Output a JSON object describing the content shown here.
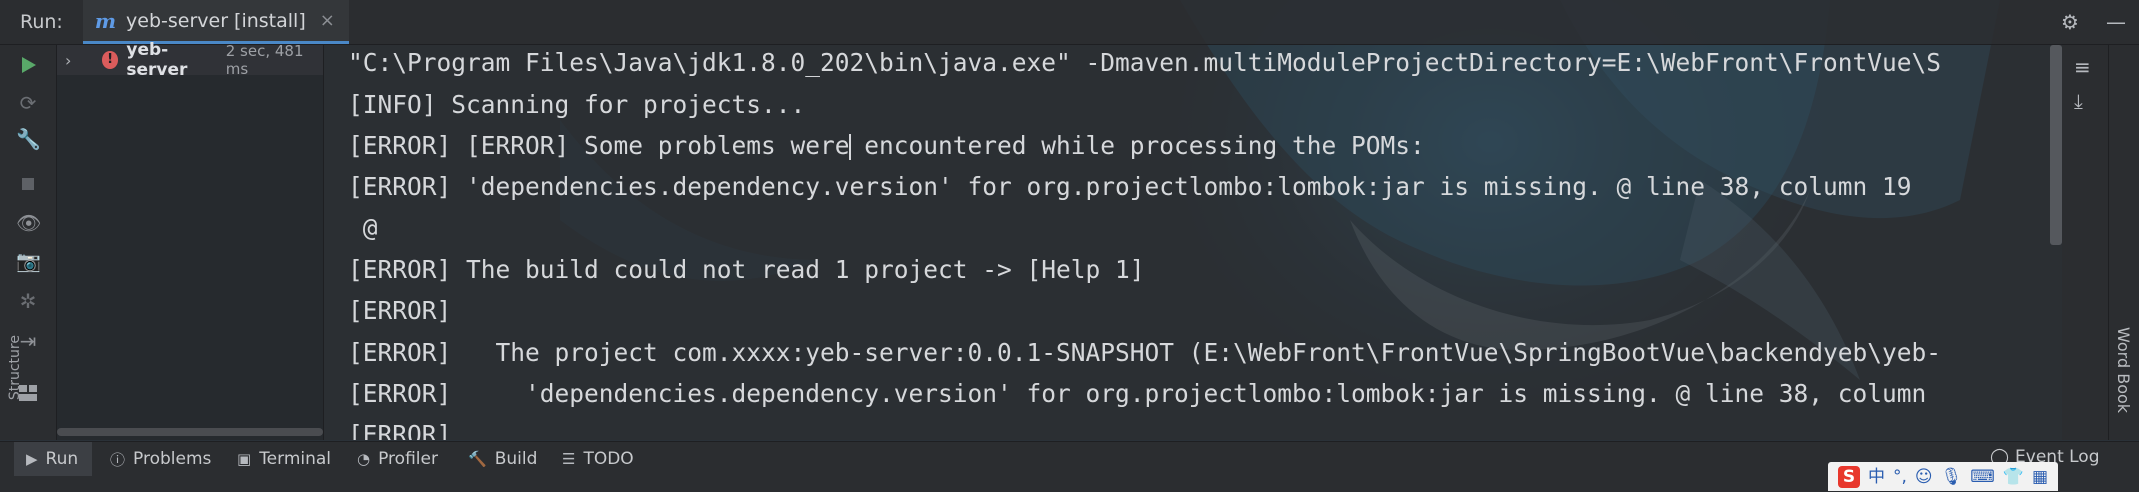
{
  "titlebar": {
    "run_label": "Run:",
    "tab_icon": "m",
    "tab_label": "yeb-server [install]",
    "tab_close": "×"
  },
  "tree": {
    "item_name": "yeb-server",
    "item_time": "2 sec, 481 ms"
  },
  "console": {
    "lines": [
      "\"C:\\Program Files\\Java\\jdk1.8.0_202\\bin\\java.exe\" -Dmaven.multiModuleProjectDirectory=E:\\WebFront\\FrontVue\\S",
      "[INFO] Scanning for projects...",
      "[ERROR] [ERROR] Some problems were encountered while processing the POMs:",
      "[ERROR] 'dependencies.dependency.version' for org.projectlombo:lombok:jar is missing. @ line 38, column 19",
      " @",
      "[ERROR] The build could not read 1 project -> [Help 1]",
      "[ERROR]",
      "[ERROR]   The project com.xxxx:yeb-server:0.0.1-SNAPSHOT (E:\\WebFront\\FrontVue\\SpringBootVue\\backendyeb\\yeb-",
      "[ERROR]     'dependencies.dependency.version' for org.projectlombo:lombok:jar is missing. @ line 38, column",
      "[ERROR]"
    ]
  },
  "side": {
    "structure_label": "Structure",
    "wordbook_label": "Word Book"
  },
  "bottom": {
    "run": "Run",
    "problems": "Problems",
    "terminal": "Terminal",
    "profiler": "Profiler",
    "build": "Build",
    "todo": "TODO",
    "event_log": "Event Log"
  },
  "ime": {
    "logo": "S",
    "lang": "中"
  },
  "colors": {
    "accent": "#4a88c7",
    "error": "#db5c5c",
    "run_green": "#59a869",
    "background": "#2b2d30"
  }
}
